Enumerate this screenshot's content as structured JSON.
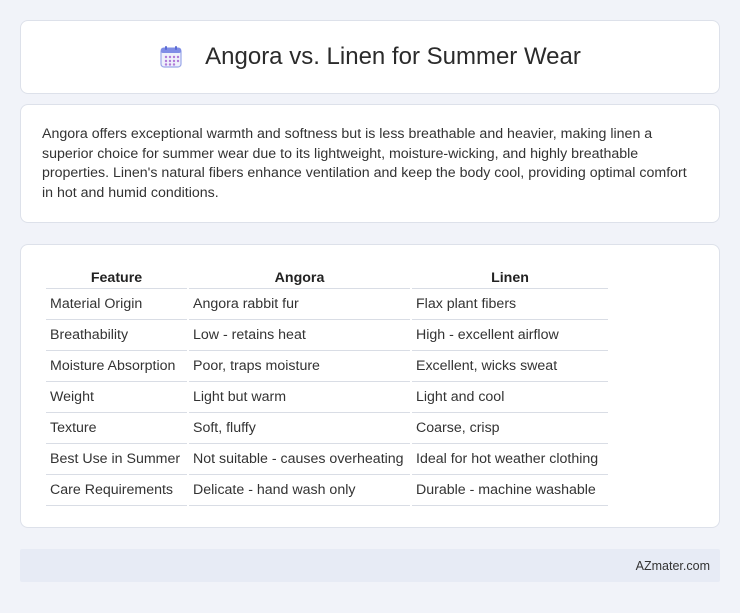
{
  "header": {
    "icon": "calendar-icon",
    "title": "Angora vs. Linen for Summer Wear"
  },
  "summary": {
    "text": "Angora offers exceptional warmth and softness but is less breathable and heavier, making linen a superior choice for summer wear due to its lightweight, moisture-wicking, and highly breathable properties. Linen's natural fibers enhance ventilation and keep the body cool, providing optimal comfort in hot and humid conditions."
  },
  "table": {
    "headers": [
      "Feature",
      "Angora",
      "Linen"
    ],
    "rows": [
      [
        "Material Origin",
        "Angora rabbit fur",
        "Flax plant fibers"
      ],
      [
        "Breathability",
        "Low - retains heat",
        "High - excellent airflow"
      ],
      [
        "Moisture Absorption",
        "Poor, traps moisture",
        "Excellent, wicks sweat"
      ],
      [
        "Weight",
        "Light but warm",
        "Light and cool"
      ],
      [
        "Texture",
        "Soft, fluffy",
        "Coarse, crisp"
      ],
      [
        "Best Use in Summer",
        "Not suitable - causes overheating",
        "Ideal for hot weather clothing"
      ],
      [
        "Care Requirements",
        "Delicate - hand wash only",
        "Durable - machine washable"
      ]
    ]
  },
  "footer": {
    "site": "AZmater.com"
  },
  "colors": {
    "background": "#f1f3f9",
    "card": "#ffffff",
    "footer": "#e7ebf5",
    "icon_accent": "#6f7fe0"
  }
}
